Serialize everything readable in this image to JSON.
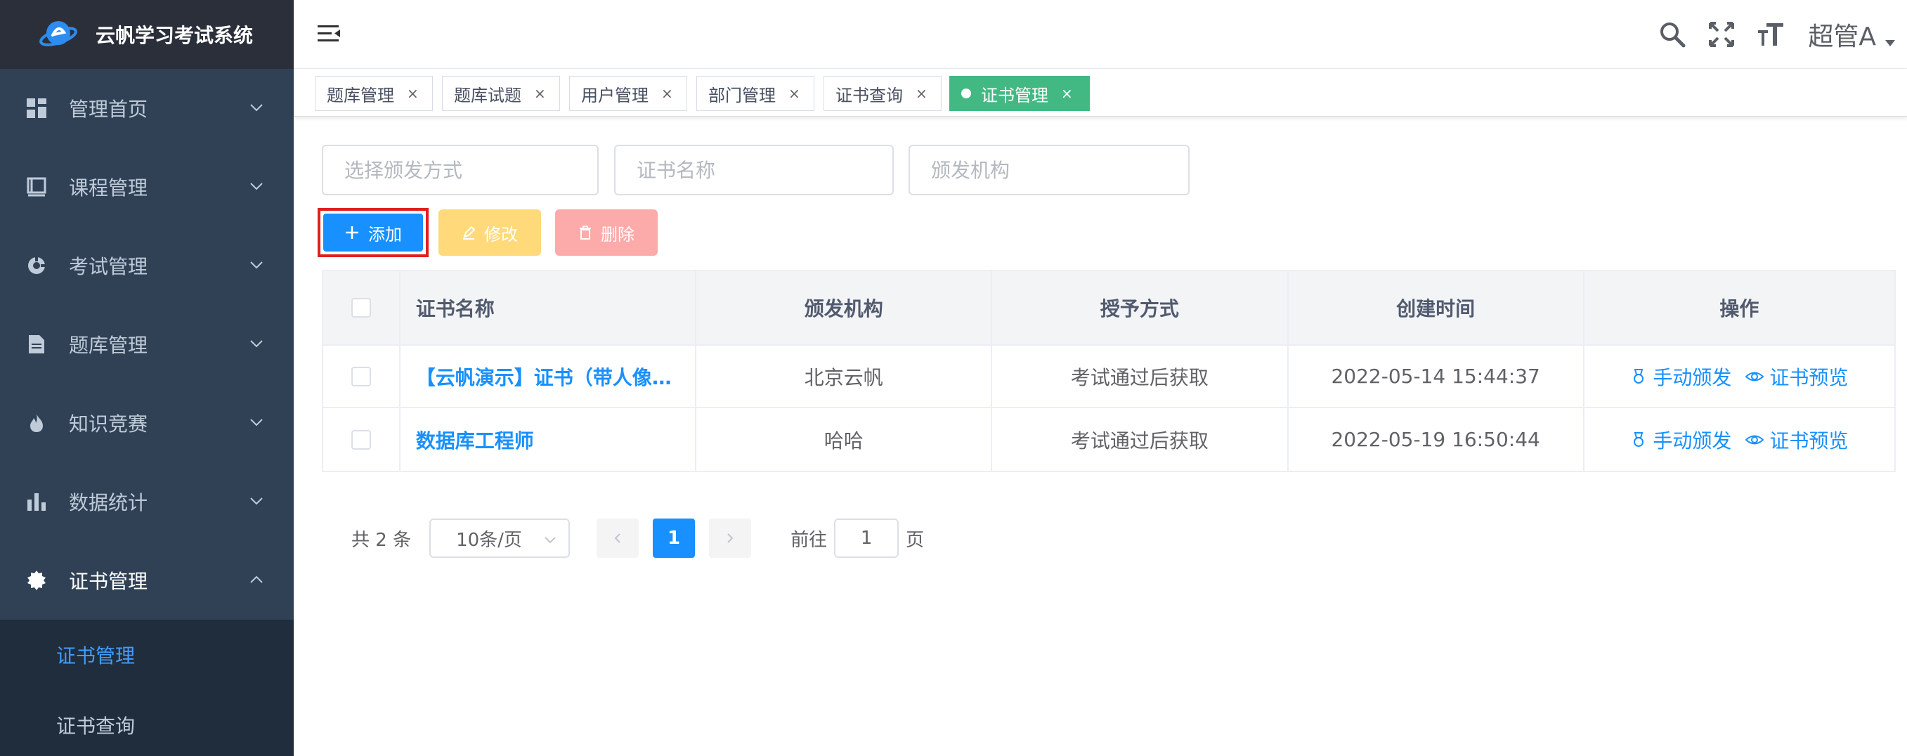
{
  "app": {
    "title": "云帆学习考试系统"
  },
  "sidebar": {
    "items": [
      {
        "label": "管理首页",
        "icon": "dashboard-icon"
      },
      {
        "label": "课程管理",
        "icon": "book-icon"
      },
      {
        "label": "考试管理",
        "icon": "exam-icon"
      },
      {
        "label": "题库管理",
        "icon": "document-icon"
      },
      {
        "label": "知识竞赛",
        "icon": "fire-icon"
      },
      {
        "label": "数据统计",
        "icon": "bar-chart-icon"
      },
      {
        "label": "证书管理",
        "icon": "certificate-icon"
      }
    ],
    "submenu": [
      {
        "label": "证书管理",
        "active": true
      },
      {
        "label": "证书查询",
        "active": false
      }
    ]
  },
  "header": {
    "user_name": "超管A"
  },
  "tags": [
    {
      "label": "题库管理"
    },
    {
      "label": "题库试题"
    },
    {
      "label": "用户管理"
    },
    {
      "label": "部门管理"
    },
    {
      "label": "证书查询"
    },
    {
      "label": "证书管理",
      "active": true
    }
  ],
  "filters": {
    "grant_type_placeholder": "选择颁发方式",
    "cert_name_placeholder": "证书名称",
    "issuer_placeholder": "颁发机构"
  },
  "toolbar": {
    "add_label": "添加",
    "edit_label": "修改",
    "delete_label": "删除"
  },
  "table": {
    "headers": {
      "name": "证书名称",
      "issuer": "颁发机构",
      "grant": "授予方式",
      "created": "创建时间",
      "ops": "操作"
    },
    "rows": [
      {
        "name": "【云帆演示】证书（带人像…",
        "issuer": "北京云帆",
        "grant": "考试通过后获取",
        "created": "2022-05-14 15:44:37",
        "op_grant": "手动颁发",
        "op_preview": "证书预览"
      },
      {
        "name": "数据库工程师",
        "issuer": "哈哈",
        "grant": "考试通过后获取",
        "created": "2022-05-19 16:50:44",
        "op_grant": "手动颁发",
        "op_preview": "证书预览"
      }
    ]
  },
  "pagination": {
    "total_text": "共 2 条",
    "page_size": "10条/页",
    "current_page": "1",
    "goto_label": "前往",
    "goto_value": "1",
    "page_suffix": "页"
  },
  "colors": {
    "sidebar_bg": "#304156",
    "primary": "#1890ff",
    "active_tag": "#42b983",
    "warning_light": "#ffd97a",
    "danger_light": "#fdaaaa"
  }
}
